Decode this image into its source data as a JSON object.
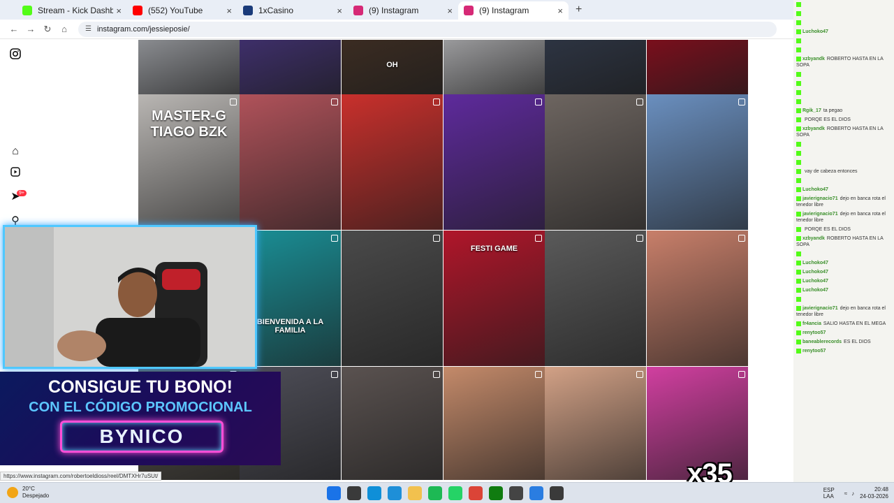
{
  "browser": {
    "tabs": [
      {
        "title": "Stream - Kick Dashboard",
        "color": "#53fc18",
        "active": false
      },
      {
        "title": "(552) YouTube",
        "color": "#ff0000",
        "active": false
      },
      {
        "title": "1xCasino",
        "color": "#1a3b7a",
        "active": false
      },
      {
        "title": "(9) Instagram",
        "color": "#d62976",
        "active": false
      },
      {
        "title": "(9) Instagram",
        "color": "#d62976",
        "active": true
      }
    ],
    "url": "instagram.com/jessieposie/"
  },
  "instagram": {
    "notification_badge": "9+",
    "posts": [
      {
        "color": "#8a8c90",
        "caption": ""
      },
      {
        "color": "#3e2f6a",
        "caption": ""
      },
      {
        "color": "#3b2c22",
        "caption": "OH"
      },
      {
        "color": "#9a9a9c",
        "caption": ""
      },
      {
        "color": "#2d3442",
        "caption": ""
      },
      {
        "color": "#7a0f1c",
        "caption": ""
      },
      {
        "color": "#b9b6b3",
        "caption": "MASTER-G TIAGO BZK"
      },
      {
        "color": "#b0525a",
        "caption": ""
      },
      {
        "color": "#c9302c",
        "caption": ""
      },
      {
        "color": "#5e2a9c",
        "caption": ""
      },
      {
        "color": "#6d6560",
        "caption": ""
      },
      {
        "color": "#6a8fbf",
        "caption": ""
      },
      {
        "color": "#2b2b2b",
        "caption": ""
      },
      {
        "color": "#1a8f96",
        "caption": "BIENVENIDA A LA FAMILIA"
      },
      {
        "color": "#4a4a4a",
        "caption": ""
      },
      {
        "color": "#b0162a",
        "caption": "FESTI GAME"
      },
      {
        "color": "#5a5a5a",
        "caption": ""
      },
      {
        "color": "#c87f6a",
        "caption": ""
      },
      {
        "color": "#555048",
        "caption": ""
      },
      {
        "color": "#4e4e58",
        "caption": ""
      },
      {
        "color": "#5a5250",
        "caption": ""
      },
      {
        "color": "#c48a6a",
        "caption": ""
      },
      {
        "color": "#d2a186",
        "caption": ""
      },
      {
        "color": "#d13fa0",
        "caption": ""
      }
    ]
  },
  "chat": {
    "messages": [
      {
        "user": "",
        "text": ""
      },
      {
        "user": "",
        "text": ""
      },
      {
        "user": "",
        "text": ""
      },
      {
        "user": "Luchoko47",
        "text": ""
      },
      {
        "user": "",
        "text": ""
      },
      {
        "user": "",
        "text": ""
      },
      {
        "user": "xzbyandk",
        "text": "ROBERTO HASTA EN LA SOPA"
      },
      {
        "user": "",
        "text": ""
      },
      {
        "user": "",
        "text": ""
      },
      {
        "user": "",
        "text": ""
      },
      {
        "user": "",
        "text": ""
      },
      {
        "user": "Rgik_17",
        "text": "ta pegao"
      },
      {
        "user": "",
        "text": "PORQE ES EL DIOS"
      },
      {
        "user": "xzbyandk",
        "text": "ROBERTO HASTA EN LA SOPA"
      },
      {
        "user": "",
        "text": ""
      },
      {
        "user": "",
        "text": ""
      },
      {
        "user": "",
        "text": ""
      },
      {
        "user": "",
        "text": "vay de cabeza entonces"
      },
      {
        "user": "",
        "text": ""
      },
      {
        "user": "Luchoko47",
        "text": ""
      },
      {
        "user": "javierignacio71",
        "text": "dejo en banca rota el tenedor libre"
      },
      {
        "user": "javierignacio71",
        "text": "dejo en banca rota el tenedor libre"
      },
      {
        "user": "",
        "text": "PORQE ES EL DIOS"
      },
      {
        "user": "xzbyandk",
        "text": "ROBERTO HASTA EN LA SOPA"
      },
      {
        "user": "",
        "text": ""
      },
      {
        "user": "Luchoko47",
        "text": ""
      },
      {
        "user": "Luchoko47",
        "text": ""
      },
      {
        "user": "Luchoko47",
        "text": ""
      },
      {
        "user": "Luchoko47",
        "text": ""
      },
      {
        "user": "",
        "text": ""
      },
      {
        "user": "javierignacio71",
        "text": "dejo en banca rota el tenedor libre"
      },
      {
        "user": "fr4ancia",
        "text": "SALIO HASTA EN EL MEGA"
      },
      {
        "user": "renytoo57",
        "text": ""
      },
      {
        "user": "baneablerecords",
        "text": "ES EL DIOS"
      },
      {
        "user": "renytoo57",
        "text": ""
      }
    ]
  },
  "overlays": {
    "promo_line1": "CONSIGUE TU BONO!",
    "promo_line2": "CON EL CÓDIGO PROMOCIONAL",
    "promo_code": "BYNICO",
    "multiplier": "x35",
    "status_url": "https://www.instagram.com/robertoeldioss/reel/DMTXHr7uSUt/"
  },
  "taskbar": {
    "weather_temp": "20°C",
    "weather_desc": "Despejado",
    "language": "ESP LAA",
    "time": "20:48",
    "date": "24-03-2026",
    "icons": [
      {
        "name": "start",
        "color": "#1a73e8"
      },
      {
        "name": "search",
        "color": "#3a3a3a"
      },
      {
        "name": "edge",
        "color": "#0f8fd8"
      },
      {
        "name": "store",
        "color": "#1e8fd8"
      },
      {
        "name": "explorer",
        "color": "#f2c14e"
      },
      {
        "name": "spotify",
        "color": "#1db954"
      },
      {
        "name": "whatsapp",
        "color": "#25d366"
      },
      {
        "name": "chrome",
        "color": "#db4437"
      },
      {
        "name": "xbox",
        "color": "#107c10"
      },
      {
        "name": "app",
        "color": "#444"
      },
      {
        "name": "notes",
        "color": "#2a7de1"
      },
      {
        "name": "obs",
        "color": "#3a3a3a"
      }
    ]
  }
}
